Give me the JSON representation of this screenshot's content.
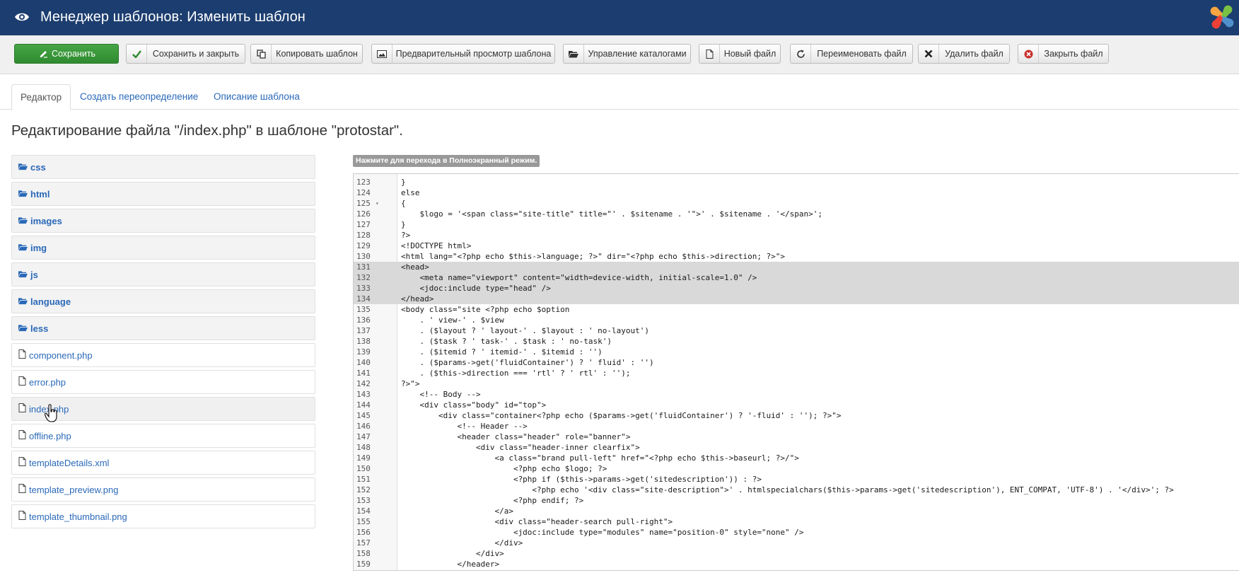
{
  "header": {
    "title": "Менеджер шаблонов: Изменить шаблон",
    "eye_icon": "eye-icon",
    "logo_icon": "joomla-logo"
  },
  "toolbar": {
    "save": "Сохранить",
    "save_close": "Сохранить и закрыть",
    "copy": "Копировать шаблон",
    "preview": "Предварительный просмотр шаблона",
    "folders": "Управление каталогами",
    "new_file": "Новый файл",
    "rename": "Переименовать файл",
    "delete": "Удалить файл",
    "close": "Закрыть файл"
  },
  "tabs": {
    "editor": "Редактор",
    "override": "Создать переопределение",
    "description": "Описание шаблона"
  },
  "page_heading": "Редактирование файла \"/index.php\" в шаблоне \"protostar\".",
  "tree": {
    "folders": [
      "css",
      "html",
      "images",
      "img",
      "js",
      "language",
      "less"
    ],
    "files": [
      "component.php",
      "error.php",
      "index.php",
      "offline.php",
      "templateDetails.xml",
      "template_preview.png",
      "template_thumbnail.png"
    ],
    "selected_file": "index.php"
  },
  "editor": {
    "fullscreen_note": "Нажмите для перехода в Полноэкранный режим.",
    "fold_marker_line": "125",
    "highlighted_lines": [
      "131",
      "132",
      "133",
      "134"
    ],
    "lines": [
      {
        "n": "123",
        "t": "}"
      },
      {
        "n": "124",
        "t": "else"
      },
      {
        "n": "125",
        "t": "{"
      },
      {
        "n": "126",
        "t": "    $logo = '<span class=\"site-title\" title=\"' . $sitename . '\">' . $sitename . '</span>';"
      },
      {
        "n": "127",
        "t": "}"
      },
      {
        "n": "128",
        "t": "?>"
      },
      {
        "n": "129",
        "t": "<!DOCTYPE html>"
      },
      {
        "n": "130",
        "t": "<html lang=\"<?php echo $this->language; ?>\" dir=\"<?php echo $this->direction; ?>\">"
      },
      {
        "n": "131",
        "t": "<head>"
      },
      {
        "n": "132",
        "t": "    <meta name=\"viewport\" content=\"width=device-width, initial-scale=1.0\" />"
      },
      {
        "n": "133",
        "t": "    <jdoc:include type=\"head\" />"
      },
      {
        "n": "134",
        "t": "</head>"
      },
      {
        "n": "135",
        "t": "<body class=\"site <?php echo $option"
      },
      {
        "n": "136",
        "t": "    . ' view-' . $view"
      },
      {
        "n": "137",
        "t": "    . ($layout ? ' layout-' . $layout : ' no-layout')"
      },
      {
        "n": "138",
        "t": "    . ($task ? ' task-' . $task : ' no-task')"
      },
      {
        "n": "139",
        "t": "    . ($itemid ? ' itemid-' . $itemid : '')"
      },
      {
        "n": "140",
        "t": "    . ($params->get('fluidContainer') ? ' fluid' : '')"
      },
      {
        "n": "141",
        "t": "    . ($this->direction === 'rtl' ? ' rtl' : '');"
      },
      {
        "n": "142",
        "t": "?>\">"
      },
      {
        "n": "143",
        "t": "    <!-- Body -->"
      },
      {
        "n": "144",
        "t": "    <div class=\"body\" id=\"top\">"
      },
      {
        "n": "145",
        "t": "        <div class=\"container<?php echo ($params->get('fluidContainer') ? '-fluid' : ''); ?>\">"
      },
      {
        "n": "146",
        "t": "            <!-- Header -->"
      },
      {
        "n": "147",
        "t": "            <header class=\"header\" role=\"banner\">"
      },
      {
        "n": "148",
        "t": "                <div class=\"header-inner clearfix\">"
      },
      {
        "n": "149",
        "t": "                    <a class=\"brand pull-left\" href=\"<?php echo $this->baseurl; ?>/\">"
      },
      {
        "n": "150",
        "t": "                        <?php echo $logo; ?>"
      },
      {
        "n": "151",
        "t": "                        <?php if ($this->params->get('sitedescription')) : ?>"
      },
      {
        "n": "152",
        "t": "                            <?php echo '<div class=\"site-description\">' . htmlspecialchars($this->params->get('sitedescription'), ENT_COMPAT, 'UTF-8') . '</div>'; ?>"
      },
      {
        "n": "153",
        "t": "                        <?php endif; ?>"
      },
      {
        "n": "154",
        "t": "                    </a>"
      },
      {
        "n": "155",
        "t": "                    <div class=\"header-search pull-right\">"
      },
      {
        "n": "156",
        "t": "                        <jdoc:include type=\"modules\" name=\"position-0\" style=\"none\" />"
      },
      {
        "n": "157",
        "t": "                    </div>"
      },
      {
        "n": "158",
        "t": "                </div>"
      },
      {
        "n": "159",
        "t": "            </header>"
      }
    ]
  },
  "colors": {
    "header_bg": "#1c3d6f",
    "save_green": "#3d9c3d",
    "link_blue": "#2a69b8"
  }
}
